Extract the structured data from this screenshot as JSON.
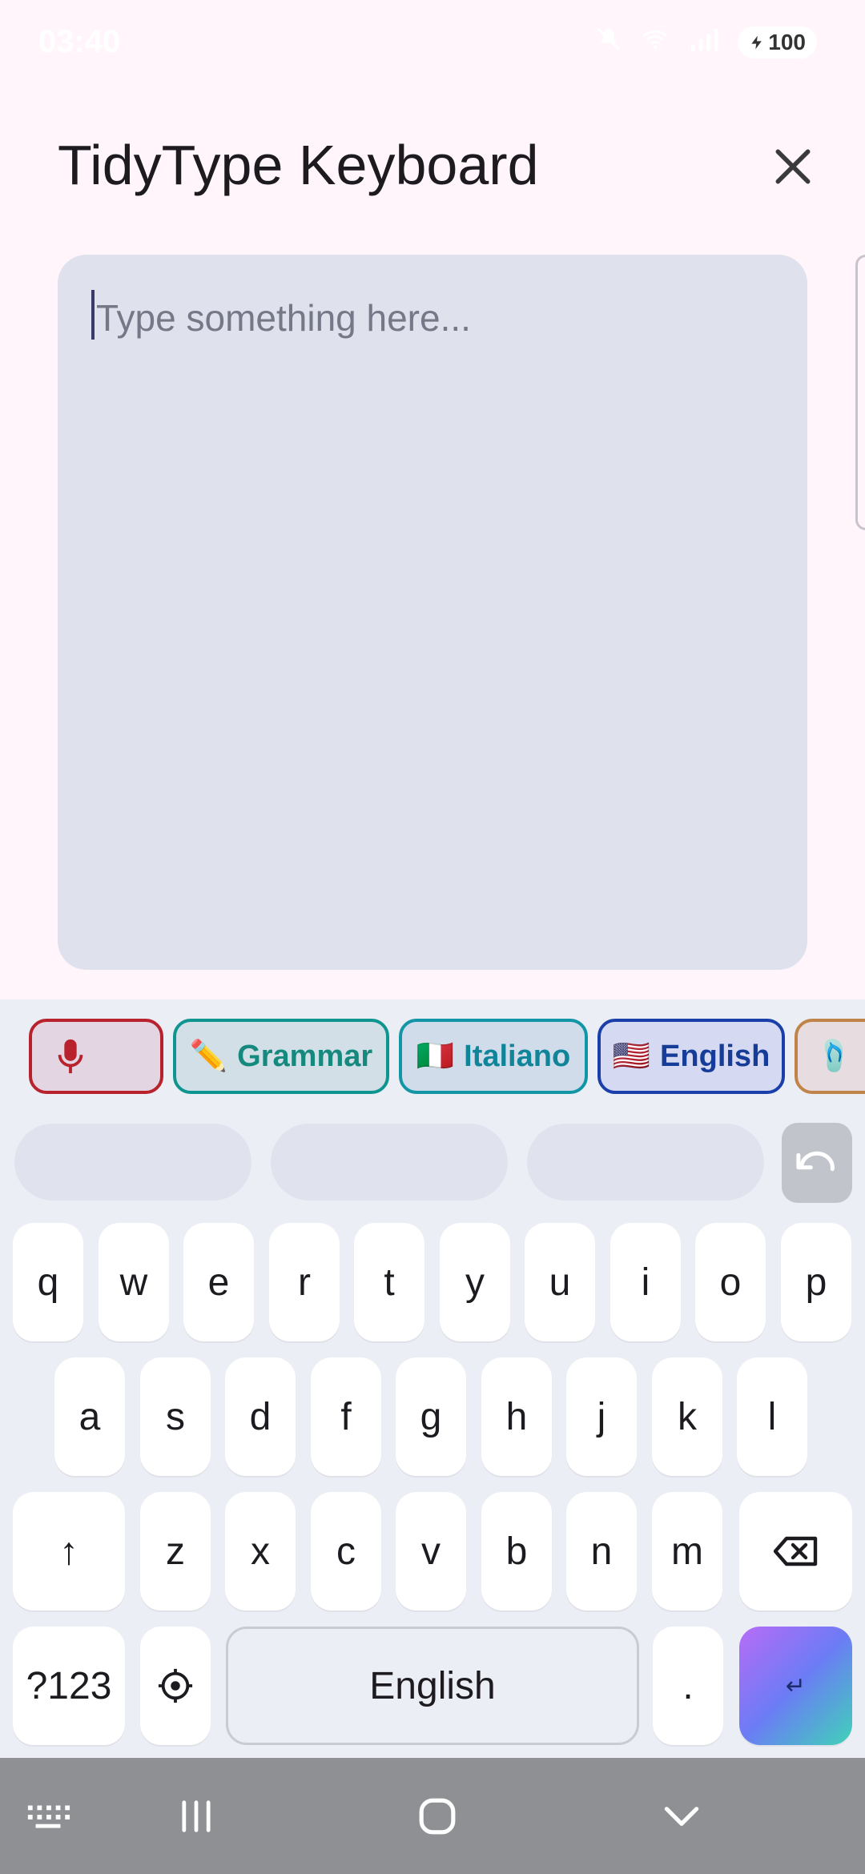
{
  "status": {
    "time": "03:40",
    "battery": "100"
  },
  "header": {
    "title": "TidyType Keyboard"
  },
  "editor": {
    "placeholder": "Type something here..."
  },
  "toolbar": {
    "chips": [
      {
        "label": ""
      },
      {
        "emoji": "✏️",
        "label": "Grammar"
      },
      {
        "emoji": "🇮🇹",
        "label": "Italiano"
      },
      {
        "emoji": "🇺🇸",
        "label": "English"
      },
      {
        "emoji": "🩴",
        "label": ""
      }
    ]
  },
  "keyboard": {
    "row1": [
      "q",
      "w",
      "e",
      "r",
      "t",
      "y",
      "u",
      "i",
      "o",
      "p"
    ],
    "row2": [
      "a",
      "s",
      "d",
      "f",
      "g",
      "h",
      "j",
      "k",
      "l"
    ],
    "row3": [
      "z",
      "x",
      "c",
      "v",
      "b",
      "n",
      "m"
    ],
    "shift": "↑",
    "symbols": "?123",
    "space_label": "English",
    "period": ".",
    "enter": "↵"
  },
  "colors": {
    "accent_red": "#b7222c",
    "accent_teal": "#0f9590",
    "accent_blue": "#1a3fa8"
  }
}
